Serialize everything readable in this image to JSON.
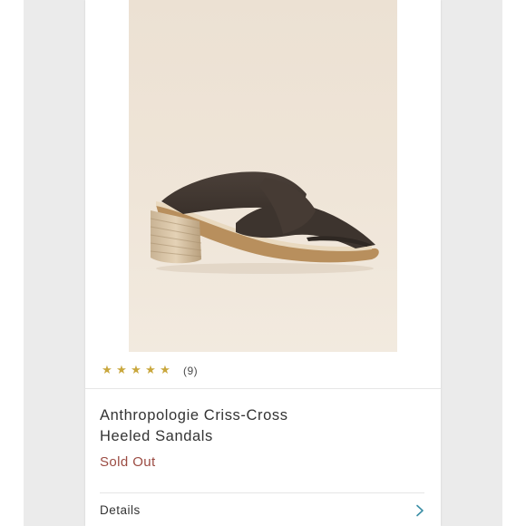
{
  "product": {
    "title_line1": "Anthropologie Criss-Cross",
    "title_line2": "Heeled Sandals",
    "status": "Sold Out",
    "image_alt": "Brown suede criss-cross heeled mule sandal with stacked wood heel"
  },
  "rating": {
    "stars": 5,
    "count_text": "(9)"
  },
  "details": {
    "label": "Details"
  },
  "colors": {
    "star": "#c9a73d",
    "status": "#9b4b42",
    "backdrop": "#ebebeb"
  },
  "icons": {
    "star": "star-icon",
    "chevron": "chevron-right-icon"
  }
}
